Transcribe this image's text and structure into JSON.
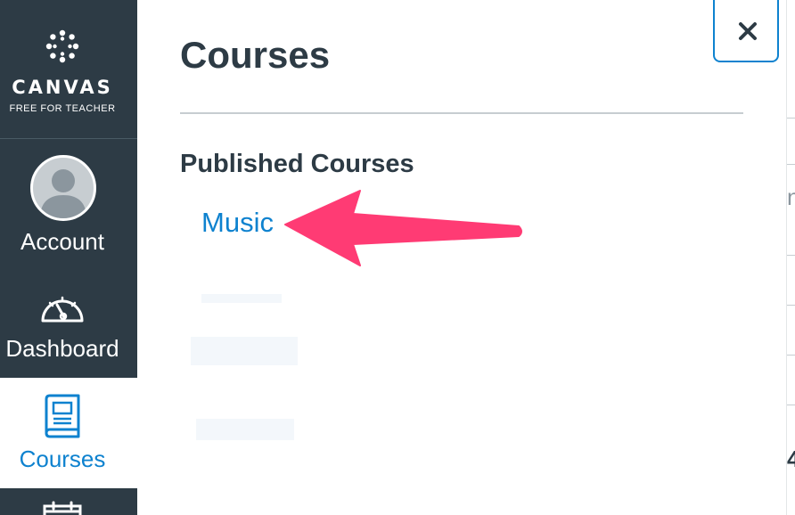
{
  "brand": {
    "name": "CANVAS",
    "subtitle": "FREE FOR TEACHER"
  },
  "nav": {
    "account": "Account",
    "dashboard": "Dashboard",
    "courses": "Courses"
  },
  "tray": {
    "title": "Courses",
    "section_heading": "Published Courses",
    "courses": [
      "Music"
    ],
    "close_label": "×"
  },
  "background": {
    "fragment_1": "nt",
    "fragment_2": "4"
  },
  "colors": {
    "nav_bg": "#2d3b45",
    "accent": "#0e82cf",
    "annotation_arrow": "#ff3b74"
  },
  "icons": {
    "logo": "canvas-logo-icon",
    "account": "avatar-icon",
    "dashboard": "dashboard-gauge-icon",
    "courses": "book-icon",
    "calendar": "calendar-icon",
    "close": "close-icon"
  }
}
